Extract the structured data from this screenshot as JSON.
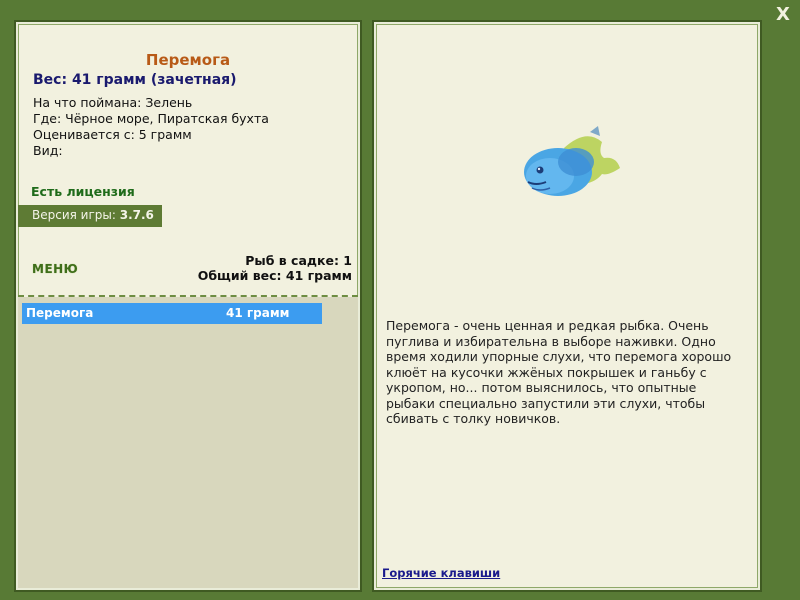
{
  "fish": {
    "name": "Перемога",
    "weight_line": "Вес: 41 грамм (зачетная)",
    "caught_on": "На что поймана: Зелень",
    "location": "Где: Чёрное море, Пиратская бухта",
    "rated_from": "Оценивается с: 5 грамм",
    "kind": "Вид:",
    "description": "Перемога - очень ценная и редкая рыбка. Очень пуглива и избирательна в выборе наживки. Одно время ходили упорные слухи, что перемога хорошо клюёт на кусочки жжёных покрышек и ганьбу с укропом, но... потом выяснилось, что опытные рыбаки специально запустили эти слухи, чтобы сбивать с толку новичков."
  },
  "license_text": "Есть лицензия",
  "version": {
    "label": "Версия игры:",
    "value": "3.7.6"
  },
  "menu_label": "МЕНЮ",
  "keep": {
    "count_line": "Рыб в садке: 1",
    "total_line": "Общий вес: 41 грамм"
  },
  "list": [
    {
      "name": "Перемога",
      "weight": "41 грамм"
    }
  ],
  "hotkeys_label": "Горячие клавиши",
  "close_label": "X",
  "icons": {
    "close": "close-icon",
    "fish": "fish-picture"
  },
  "colors": {
    "background": "#587a35",
    "panel": "#f2f1df",
    "list_bg": "#d8d7bd",
    "selected_row": "#3c9cf0",
    "title": "#b85a17",
    "weight": "#1a1a6e",
    "license": "#1f6b1a",
    "version_bar": "#5e7b34",
    "link": "#1a1a8c"
  }
}
